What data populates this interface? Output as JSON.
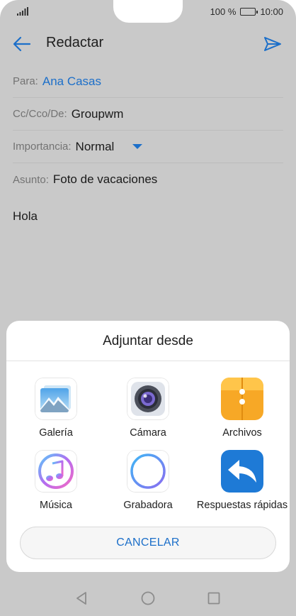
{
  "status": {
    "battery_text": "100 %",
    "time": "10:00",
    "battery_level": 1.0
  },
  "appbar": {
    "title": "Redactar"
  },
  "compose": {
    "to_label": "Para:",
    "to_value": "Ana Casas",
    "cc_label": "Cc/Cco/De:",
    "cc_value": "Groupwm",
    "importance_label": "Importancia:",
    "importance_value": "Normal",
    "subject_label": "Asunto:",
    "subject_value": "Foto de vacaciones",
    "body": "Hola"
  },
  "attach_sheet": {
    "title": "Adjuntar desde",
    "options": [
      {
        "label": "Galería",
        "icon": "gallery-icon"
      },
      {
        "label": "Cámara",
        "icon": "camera-icon"
      },
      {
        "label": "Archivos",
        "icon": "files-icon"
      },
      {
        "label": "Música",
        "icon": "music-icon"
      },
      {
        "label": "Grabadora",
        "icon": "recorder-icon"
      },
      {
        "label": "Respuestas rápidas",
        "icon": "quick-reply-icon"
      }
    ],
    "cancel_label": "CANCELAR"
  },
  "colors": {
    "accent": "#1c6fc9",
    "scrim": "#c9c9c9",
    "files_icon": "#f7a826",
    "quick_reply_icon": "#1e7ad6"
  }
}
